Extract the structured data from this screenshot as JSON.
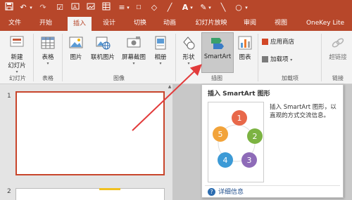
{
  "qat": {
    "save_icon": "save-icon",
    "undo_icon": "undo-icon",
    "redo_icon": "redo-icon",
    "checkbox_icon": "checkbox-icon",
    "textbox_icon": "textbox-icon",
    "picture_icon": "picture-icon",
    "table_icon": "table-icon",
    "font_color_letter": "A",
    "line_icon": "line-icon",
    "shape_icon": "circle-icon"
  },
  "tabs": [
    "文件",
    "开始",
    "插入",
    "设计",
    "切换",
    "动画",
    "幻灯片放映",
    "审阅",
    "视图",
    "OneKey Lite"
  ],
  "ribbon": {
    "new_slide": {
      "line1": "新建",
      "line2": "幻灯片"
    },
    "table": "表格",
    "picture": "图片",
    "online_picture": "联机图片",
    "screenshot": "屏幕截图",
    "album": "相册",
    "shapes": "形状",
    "smartart": "SmartArt",
    "chart": "图表",
    "store": "应用商店",
    "addins": "加载项",
    "superlink": "超链接",
    "groups": {
      "slides": "幻灯片",
      "tables": "表格",
      "images": "图像",
      "illustrations": "插图",
      "addins": "加载项",
      "links": "链接"
    }
  },
  "slides": {
    "first_num": "1",
    "second_num": "2"
  },
  "tooltip": {
    "title": "插入 SmartArt 图形",
    "description": "插入 SmartArt 图形，以直观的方式交流信息。",
    "help": "详细信息",
    "cycle_numbers": [
      "1",
      "2",
      "3",
      "4",
      "5"
    ]
  },
  "colors": {
    "brand": "#b7472a",
    "arrow": "#e23b3b"
  }
}
